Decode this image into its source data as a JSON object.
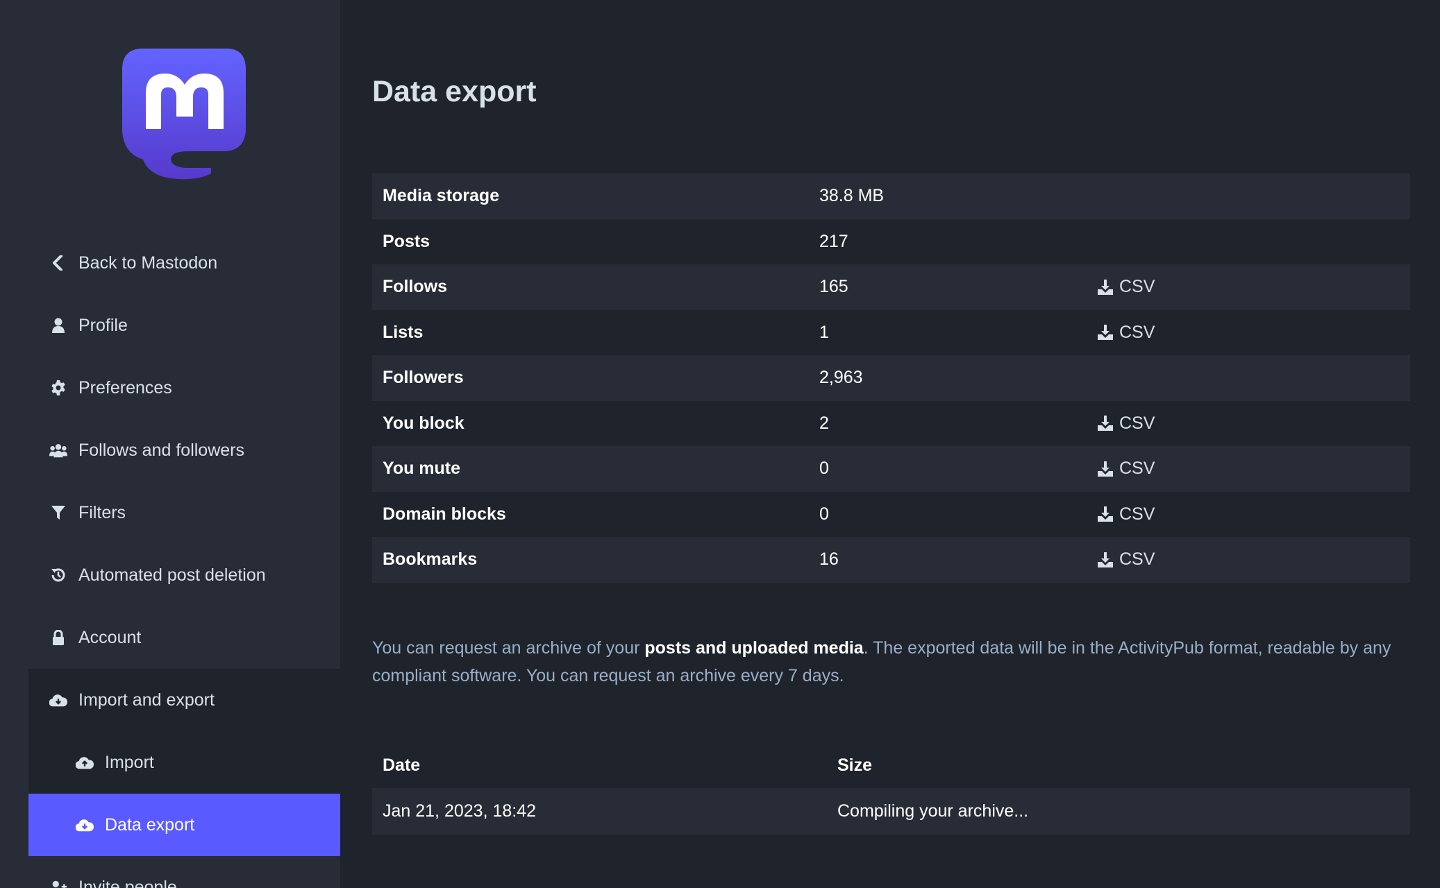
{
  "sidebar": {
    "items": [
      {
        "label": "Back to Mastodon",
        "icon": "chevron-left-icon"
      },
      {
        "label": "Profile",
        "icon": "user-icon"
      },
      {
        "label": "Preferences",
        "icon": "gear-icon"
      },
      {
        "label": "Follows and followers",
        "icon": "users-icon"
      },
      {
        "label": "Filters",
        "icon": "filter-icon"
      },
      {
        "label": "Automated post deletion",
        "icon": "history-icon"
      },
      {
        "label": "Account",
        "icon": "lock-icon"
      },
      {
        "label": "Import and export",
        "icon": "cloud-download-icon"
      },
      {
        "label": "Import",
        "icon": "cloud-upload-icon"
      },
      {
        "label": "Data export",
        "icon": "cloud-download-icon"
      },
      {
        "label": "Invite people",
        "icon": "user-plus-icon"
      }
    ]
  },
  "main": {
    "title": "Data export",
    "stats": [
      {
        "label": "Media storage",
        "value": "38.8 MB",
        "download": ""
      },
      {
        "label": "Posts",
        "value": "217",
        "download": ""
      },
      {
        "label": "Follows",
        "value": "165",
        "download": "CSV"
      },
      {
        "label": "Lists",
        "value": "1",
        "download": "CSV"
      },
      {
        "label": "Followers",
        "value": "2,963",
        "download": ""
      },
      {
        "label": "You block",
        "value": "2",
        "download": "CSV"
      },
      {
        "label": "You mute",
        "value": "0",
        "download": "CSV"
      },
      {
        "label": "Domain blocks",
        "value": "0",
        "download": "CSV"
      },
      {
        "label": "Bookmarks",
        "value": "16",
        "download": "CSV"
      }
    ],
    "hint": {
      "before": "You can request an archive of your ",
      "strong": "posts and uploaded media",
      "after": ". The exported data will be in the ActivityPub format, readable by any compliant software. You can request an archive every 7 days."
    },
    "archive": {
      "date_header": "Date",
      "size_header": "Size",
      "rows": [
        {
          "date": "Jan 21, 2023, 18:42",
          "size": "Compiling your archive..."
        }
      ]
    }
  },
  "colors": {
    "accent": "#595aff",
    "sidebar_bg": "#282c37",
    "page_bg": "#1f232b",
    "logo_top": "#6364ff",
    "logo_bottom": "#563acc"
  }
}
